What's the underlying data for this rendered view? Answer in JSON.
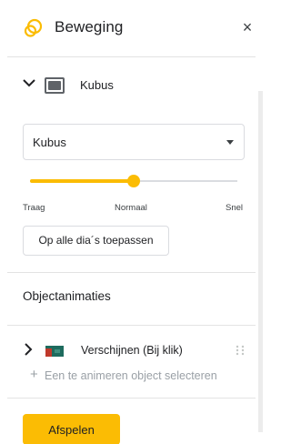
{
  "header": {
    "title": "Beweging",
    "close_symbol": "×",
    "logo_icon": "motion-rings-icon",
    "accent_color": "#fbbc04"
  },
  "transition": {
    "expanded": true,
    "label": "Kubus",
    "thumb_icon": "slide-thumbnail-icon"
  },
  "transition_type": {
    "selected": "Kubus"
  },
  "speed": {
    "level": 0.5,
    "labels": {
      "slow": "Traag",
      "normal": "Normaal",
      "fast": "Snel"
    }
  },
  "apply_all_label": "Op alle dia´s toepassen",
  "object_animations": {
    "title": "Objectanimaties",
    "items": [
      {
        "label": "Verschijnen  (Bij klik)",
        "thumb_icon": "object-thumbnail-icon"
      }
    ],
    "add_label": "Een te animeren object selecteren",
    "add_symbol": "+"
  },
  "play_label": "Afspelen"
}
